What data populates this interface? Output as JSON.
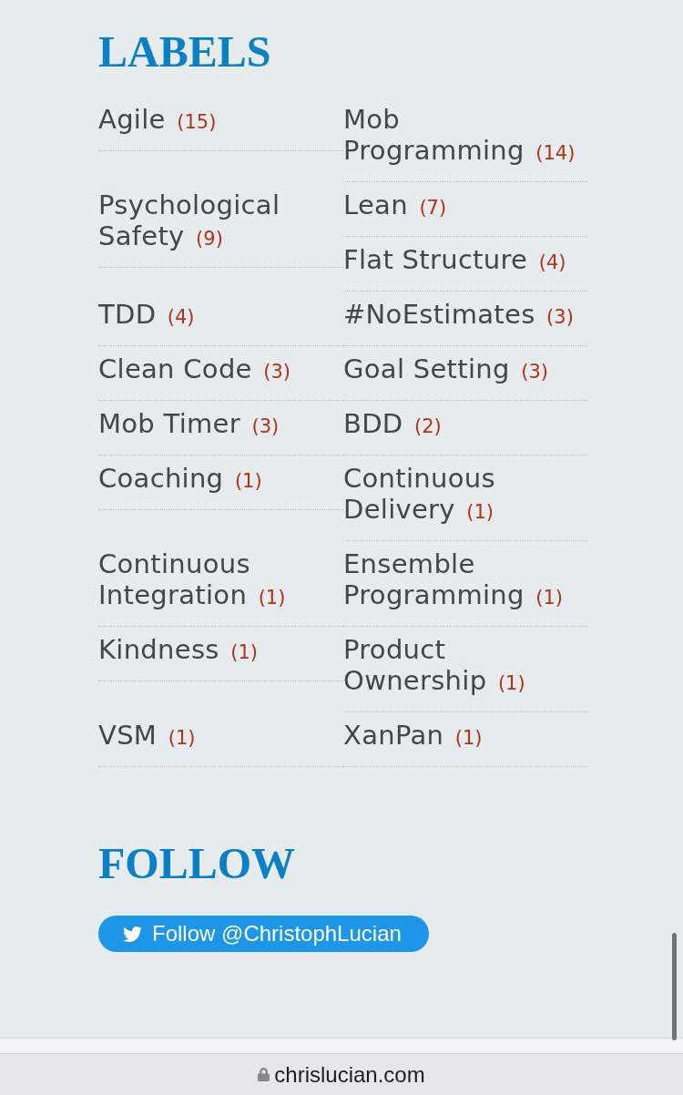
{
  "sections": [
    {
      "kind": "labels",
      "heading": "LABELS",
      "labels": [
        {
          "name": "Agile",
          "count": "(15)"
        },
        {
          "name": "Mob Programming",
          "count": "(14)"
        },
        {
          "name": "Psychological Safety",
          "count": "(9)"
        },
        {
          "name": "Lean",
          "count": "(7)"
        },
        {
          "name": "Flat Structure",
          "count": "(4)"
        },
        {
          "name": "TDD",
          "count": "(4)"
        },
        {
          "name": "#NoEstimates",
          "count": "(3)"
        },
        {
          "name": "Clean Code",
          "count": "(3)"
        },
        {
          "name": "Goal Setting",
          "count": "(3)"
        },
        {
          "name": "Mob Timer",
          "count": "(3)"
        },
        {
          "name": "BDD",
          "count": "(2)"
        },
        {
          "name": "Coaching",
          "count": "(1)"
        },
        {
          "name": "Continuous Delivery",
          "count": "(1)"
        },
        {
          "name": "Continuous Integration",
          "count": "(1)"
        },
        {
          "name": "Ensemble Programming",
          "count": "(1)"
        },
        {
          "name": "Kindness",
          "count": "(1)"
        },
        {
          "name": "Product Ownership",
          "count": "(1)"
        },
        {
          "name": "VSM",
          "count": "(1)"
        },
        {
          "name": "XanPan",
          "count": "(1)"
        }
      ]
    },
    {
      "kind": "follow",
      "heading": "FOLLOW",
      "button": "Follow @ChristophLucian"
    }
  ],
  "address_bar": {
    "url": "chrislucian.com"
  }
}
